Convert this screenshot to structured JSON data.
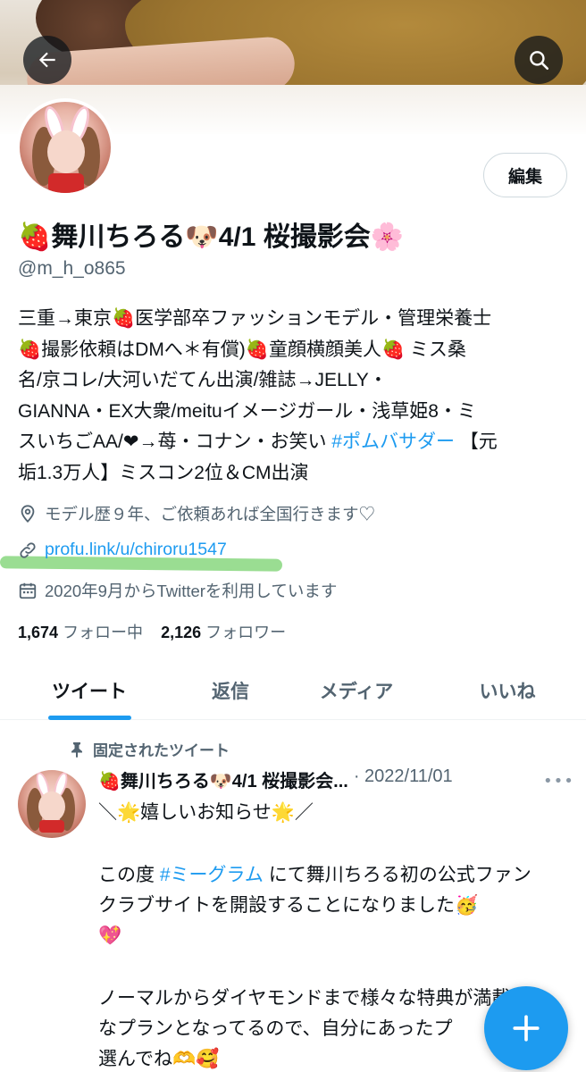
{
  "profile": {
    "name": "🍓舞川ちろる🐶4/1 桜撮影会🌸",
    "handle": "@m_h_o865",
    "edit_label": "編集",
    "bio_lines": [
      "三重→東京🍓医学部卒ファッションモデル・管理栄養士",
      "🍓撮影依頼はDMへ＊有償)🍓童顔横顔美人🍓 ミス桑",
      "名/京コレ/大河いだてん出演/雑誌→JELLY・",
      "GIANNA・EX大衆/meituイメージガール・浅草姫8・ミ"
    ],
    "bio_line5_pre": "スいちごAA/❤→苺・コナン・お笑い ",
    "bio_line5_hashtag": "#ポムバサダー",
    "bio_line5_post": " 【元",
    "bio_line6": "垢1.3万人】ミスコン2位＆CM出演",
    "location": "モデル歴９年、ご依頼あれば全国行きます♡",
    "url": "profu.link/u/chiroru1547",
    "joined": "2020年9月からTwitterを利用しています",
    "following_count": "1,674",
    "following_label": "フォロー中",
    "followers_count": "2,126",
    "followers_label": "フォロワー"
  },
  "tabs": [
    "ツイート",
    "返信",
    "メディア",
    "いいね"
  ],
  "active_tab": "ツイート",
  "pinned_tweet": {
    "pinned_label": "固定されたツイート",
    "author": "🍓舞川ちろる🐶4/1 桜撮影会...",
    "date": "· 2022/11/01",
    "line1": "＼🌟嬉しいお知らせ🌟／",
    "line2_pre": "この度 ",
    "line2_hashtag": "#ミーグラム",
    "line2_post": " にて舞川ちろる初の公式ファン",
    "line3": "クラブサイトを開設することになりました🥳",
    "line4": "💖",
    "line5": "ノーマルからダイヤモンドまで様々な特典が満載",
    "line6": "なプランとなってるので、自分にあったプ",
    "line7": "選んでね🫶🥰"
  },
  "colors": {
    "accent": "#1d9bf0",
    "text_primary": "#0f1419",
    "text_secondary": "#536471",
    "highlight_marker": "#78d26e"
  },
  "icons": [
    "back-arrow-icon",
    "search-icon",
    "location-pin-icon",
    "link-icon",
    "calendar-icon",
    "pin-icon",
    "more-dots-icon",
    "compose-plus-icon"
  ]
}
